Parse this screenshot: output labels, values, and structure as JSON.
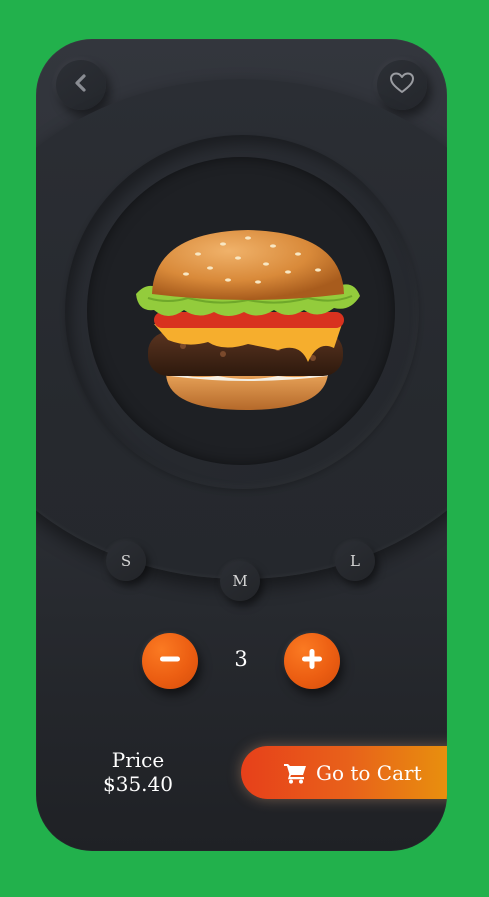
{
  "header": {
    "back_icon": "chevron-left-icon",
    "favorite_icon": "heart-outline-icon"
  },
  "product": {
    "image": "burger-illustration"
  },
  "sizes": [
    {
      "label": "S"
    },
    {
      "label": "M"
    },
    {
      "label": "L"
    }
  ],
  "quantity": {
    "value": "3",
    "decrement_icon": "minus-icon",
    "increment_icon": "plus-icon"
  },
  "price": {
    "label": "Price",
    "value": "$35.40"
  },
  "cart": {
    "label": "Go to Cart",
    "icon": "cart-icon"
  },
  "colors": {
    "background": "#22b14c",
    "card": "#2b2e34",
    "accent": "#ec5e12",
    "cart_gradient_end": "#e8960c"
  }
}
